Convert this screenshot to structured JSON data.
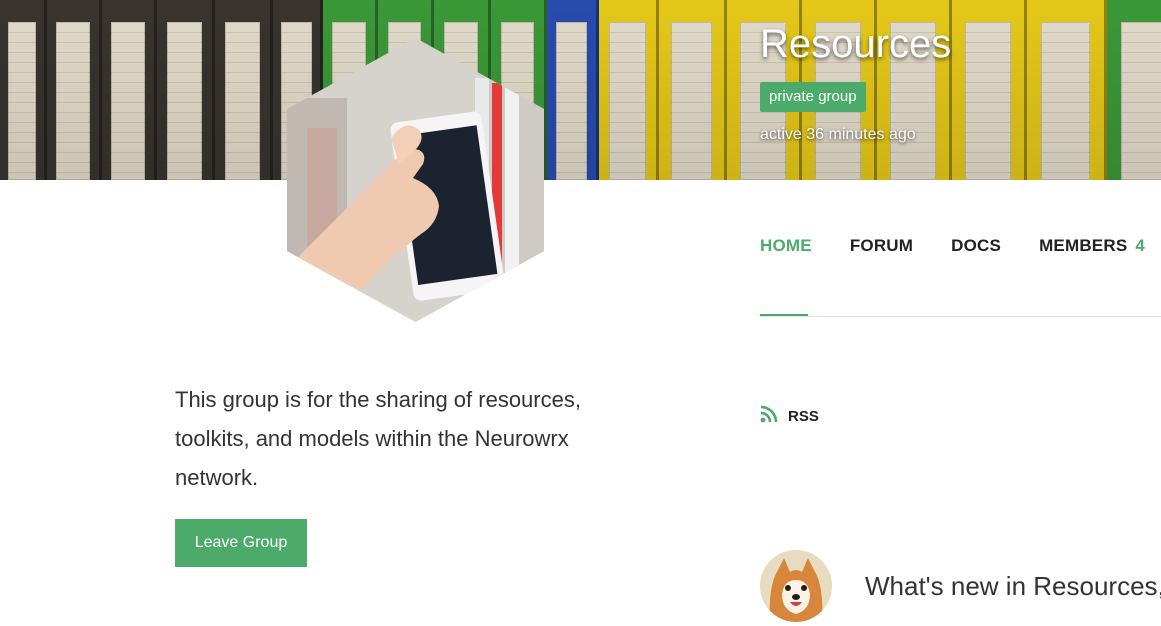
{
  "group": {
    "title": "Resources",
    "privacy_badge": "private group",
    "activity": "active 36 minutes ago",
    "description": "This group is for the sharing of resources, toolkits, and models within the Neurowrx network."
  },
  "nav": {
    "items": [
      {
        "label": "HOME",
        "active": true
      },
      {
        "label": "FORUM",
        "active": false
      },
      {
        "label": "DOCS",
        "active": false
      },
      {
        "label": "MEMBERS",
        "active": false,
        "count": "4"
      }
    ]
  },
  "actions": {
    "leave_label": "Leave Group",
    "rss_label": "RSS"
  },
  "activity_post": {
    "prompt": "What's new in Resources, j"
  },
  "colors": {
    "accent": "#4caa6b",
    "text": "#333333"
  },
  "icons": {
    "rss": "rss-icon",
    "avatar": "shiba-avatar"
  }
}
